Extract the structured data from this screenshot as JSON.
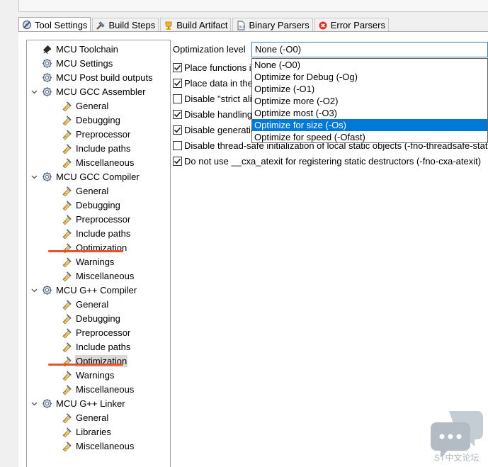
{
  "tabs": [
    {
      "label": "Tool Settings",
      "icon": "tool-settings-icon",
      "active": true
    },
    {
      "label": "Build Steps",
      "icon": "build-steps-icon"
    },
    {
      "label": "Build Artifact",
      "icon": "trophy-icon"
    },
    {
      "label": "Binary Parsers",
      "icon": "binary-icon"
    },
    {
      "label": "Error Parsers",
      "icon": "error-icon"
    }
  ],
  "tree": [
    {
      "label": "MCU Toolchain",
      "level": 0,
      "icon": "toolchain-icon"
    },
    {
      "label": "MCU Settings",
      "level": 0,
      "icon": "settings-gear-icon"
    },
    {
      "label": "MCU Post build outputs",
      "level": 0,
      "icon": "settings-gear-icon"
    },
    {
      "label": "MCU GCC Assembler",
      "level": 0,
      "icon": "settings-gear-icon",
      "expanded": true
    },
    {
      "label": "General",
      "level": 1,
      "icon": "tool-option-icon"
    },
    {
      "label": "Debugging",
      "level": 1,
      "icon": "tool-option-icon"
    },
    {
      "label": "Preprocessor",
      "level": 1,
      "icon": "tool-option-icon"
    },
    {
      "label": "Include paths",
      "level": 1,
      "icon": "tool-option-icon"
    },
    {
      "label": "Miscellaneous",
      "level": 1,
      "icon": "tool-option-icon"
    },
    {
      "label": "MCU GCC Compiler",
      "level": 0,
      "icon": "settings-gear-icon",
      "expanded": true
    },
    {
      "label": "General",
      "level": 1,
      "icon": "tool-option-icon"
    },
    {
      "label": "Debugging",
      "level": 1,
      "icon": "tool-option-icon"
    },
    {
      "label": "Preprocessor",
      "level": 1,
      "icon": "tool-option-icon"
    },
    {
      "label": "Include paths",
      "level": 1,
      "icon": "tool-option-icon"
    },
    {
      "label": "Optimization",
      "level": 1,
      "icon": "tool-option-icon",
      "annotated": true
    },
    {
      "label": "Warnings",
      "level": 1,
      "icon": "tool-option-icon"
    },
    {
      "label": "Miscellaneous",
      "level": 1,
      "icon": "tool-option-icon"
    },
    {
      "label": "MCU G++ Compiler",
      "level": 0,
      "icon": "settings-gear-icon",
      "expanded": true
    },
    {
      "label": "General",
      "level": 1,
      "icon": "tool-option-icon"
    },
    {
      "label": "Debugging",
      "level": 1,
      "icon": "tool-option-icon"
    },
    {
      "label": "Preprocessor",
      "level": 1,
      "icon": "tool-option-icon"
    },
    {
      "label": "Include paths",
      "level": 1,
      "icon": "tool-option-icon"
    },
    {
      "label": "Optimization",
      "level": 1,
      "icon": "tool-option-icon",
      "selected": true,
      "annotated": true
    },
    {
      "label": "Warnings",
      "level": 1,
      "icon": "tool-option-icon"
    },
    {
      "label": "Miscellaneous",
      "level": 1,
      "icon": "tool-option-icon"
    },
    {
      "label": "MCU G++ Linker",
      "level": 0,
      "icon": "settings-gear-icon",
      "expanded": true
    },
    {
      "label": "General",
      "level": 1,
      "icon": "tool-option-icon"
    },
    {
      "label": "Libraries",
      "level": 1,
      "icon": "tool-option-icon"
    },
    {
      "label": "Miscellaneous",
      "level": 1,
      "icon": "tool-option-icon"
    }
  ],
  "optimization": {
    "label": "Optimization level",
    "selected": "None (-O0)",
    "options": [
      "None (-O0)",
      "Optimize for Debug (-Og)",
      "Optimize (-O1)",
      "Optimize more (-O2)",
      "Optimize most (-O3)",
      "Optimize for size (-Os)",
      "Optimize for speed (-Ofast)"
    ],
    "highlighted_index": 5
  },
  "checkboxes": [
    {
      "label": "Place functions in their own sections (-ffunction-sections)",
      "checked": true
    },
    {
      "label": "Place data in their own sections (-fdata-sections)",
      "checked": true
    },
    {
      "label": "Disable \"strict aliasing\" optimization (-fno-strict-aliasing)",
      "checked": false
    },
    {
      "label": "Disable handling exceptions (-fno-exceptions)",
      "checked": true
    },
    {
      "label": "Disable generation of information about every class (-fno-rtti)",
      "checked": true
    },
    {
      "label": "Disable thread-safe initialization of local static objects (-fno-threadsafe-statics)",
      "checked": false
    },
    {
      "label": "Do not use __cxa_atexit for registering static destructors (-fno-cxa-atexit)",
      "checked": true
    }
  ],
  "watermark": {
    "text": "ST中文论坛",
    "icon": "chat-bubbles-icon"
  },
  "colors": {
    "selection": "#0078d7",
    "annotation": "#e8512a",
    "combo_border": "#3c7fb1"
  }
}
